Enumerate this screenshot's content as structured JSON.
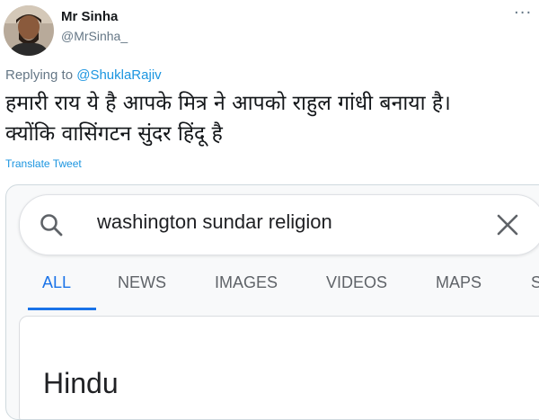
{
  "tweet": {
    "display_name": "Mr Sinha",
    "handle": "@MrSinha_",
    "more_icon": "···",
    "replying_prefix": "Replying to ",
    "replying_to": "@ShuklaRajiv",
    "text_line1": "हमारी राय ये है आपके मित्र ने आपको राहुल गांधी बनाया है।",
    "text_line2": "क्योंकि वासिंगटन सुंदर हिंदू है",
    "translate_link": "Translate Tweet"
  },
  "embedded_search": {
    "query": "washington sundar religion",
    "tabs": [
      {
        "label": "ALL",
        "active": true
      },
      {
        "label": "NEWS",
        "active": false
      },
      {
        "label": "IMAGES",
        "active": false
      },
      {
        "label": "VIDEOS",
        "active": false
      },
      {
        "label": "MAPS",
        "active": false
      },
      {
        "label": "S",
        "active": false
      }
    ],
    "answer": "Hindu"
  },
  "colors": {
    "link": "#1b95e0",
    "active_tab": "#1a73e8",
    "text": "#14171a",
    "muted": "#657786"
  },
  "icons": [
    "avatar",
    "more-icon",
    "search-icon",
    "close-icon"
  ]
}
